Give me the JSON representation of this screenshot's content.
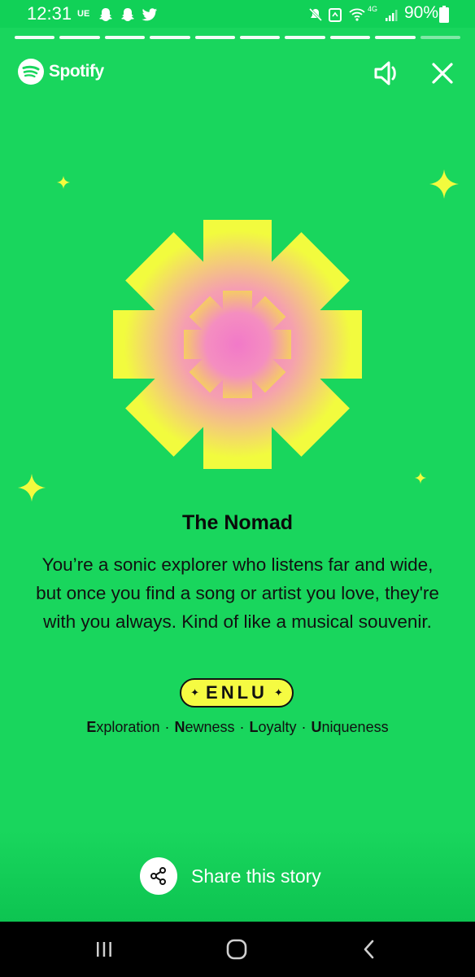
{
  "status_bar": {
    "time": "12:31",
    "carrier": "UE",
    "network": "4G",
    "battery": "90%",
    "icons": [
      "snapchat-icon",
      "snapchat-icon",
      "twitter-icon",
      "mute-icon",
      "recycle-icon",
      "wifi-icon",
      "signal-icon",
      "battery-icon"
    ]
  },
  "story_progress": {
    "segments": 10,
    "completed": 9
  },
  "header": {
    "logo_text": "Spotify",
    "icons": [
      "spotify-logo-icon",
      "speaker-icon",
      "close-icon"
    ]
  },
  "card": {
    "title": "The Nomad",
    "description": "You’re a sonic explorer who listens far and wide, but once you find a song or artist you love, they're with you always. Kind of like a musical souvenir.",
    "badge_code": "ENLU",
    "traits": [
      {
        "initial": "E",
        "rest": "xploration"
      },
      {
        "initial": "N",
        "rest": "ewness"
      },
      {
        "initial": "L",
        "rest": "oyalty"
      },
      {
        "initial": "U",
        "rest": "niqueness"
      }
    ],
    "trait_separator": "·"
  },
  "share": {
    "label": "Share this story",
    "icon": "share-icon"
  },
  "nav_bar": {
    "icons": [
      "recent-apps-icon",
      "home-icon",
      "back-icon"
    ]
  },
  "colors": {
    "background": "#19d65d",
    "badge": "#f5fb42",
    "art_edge": "#f2fb3e",
    "art_center": "#f279c8"
  }
}
